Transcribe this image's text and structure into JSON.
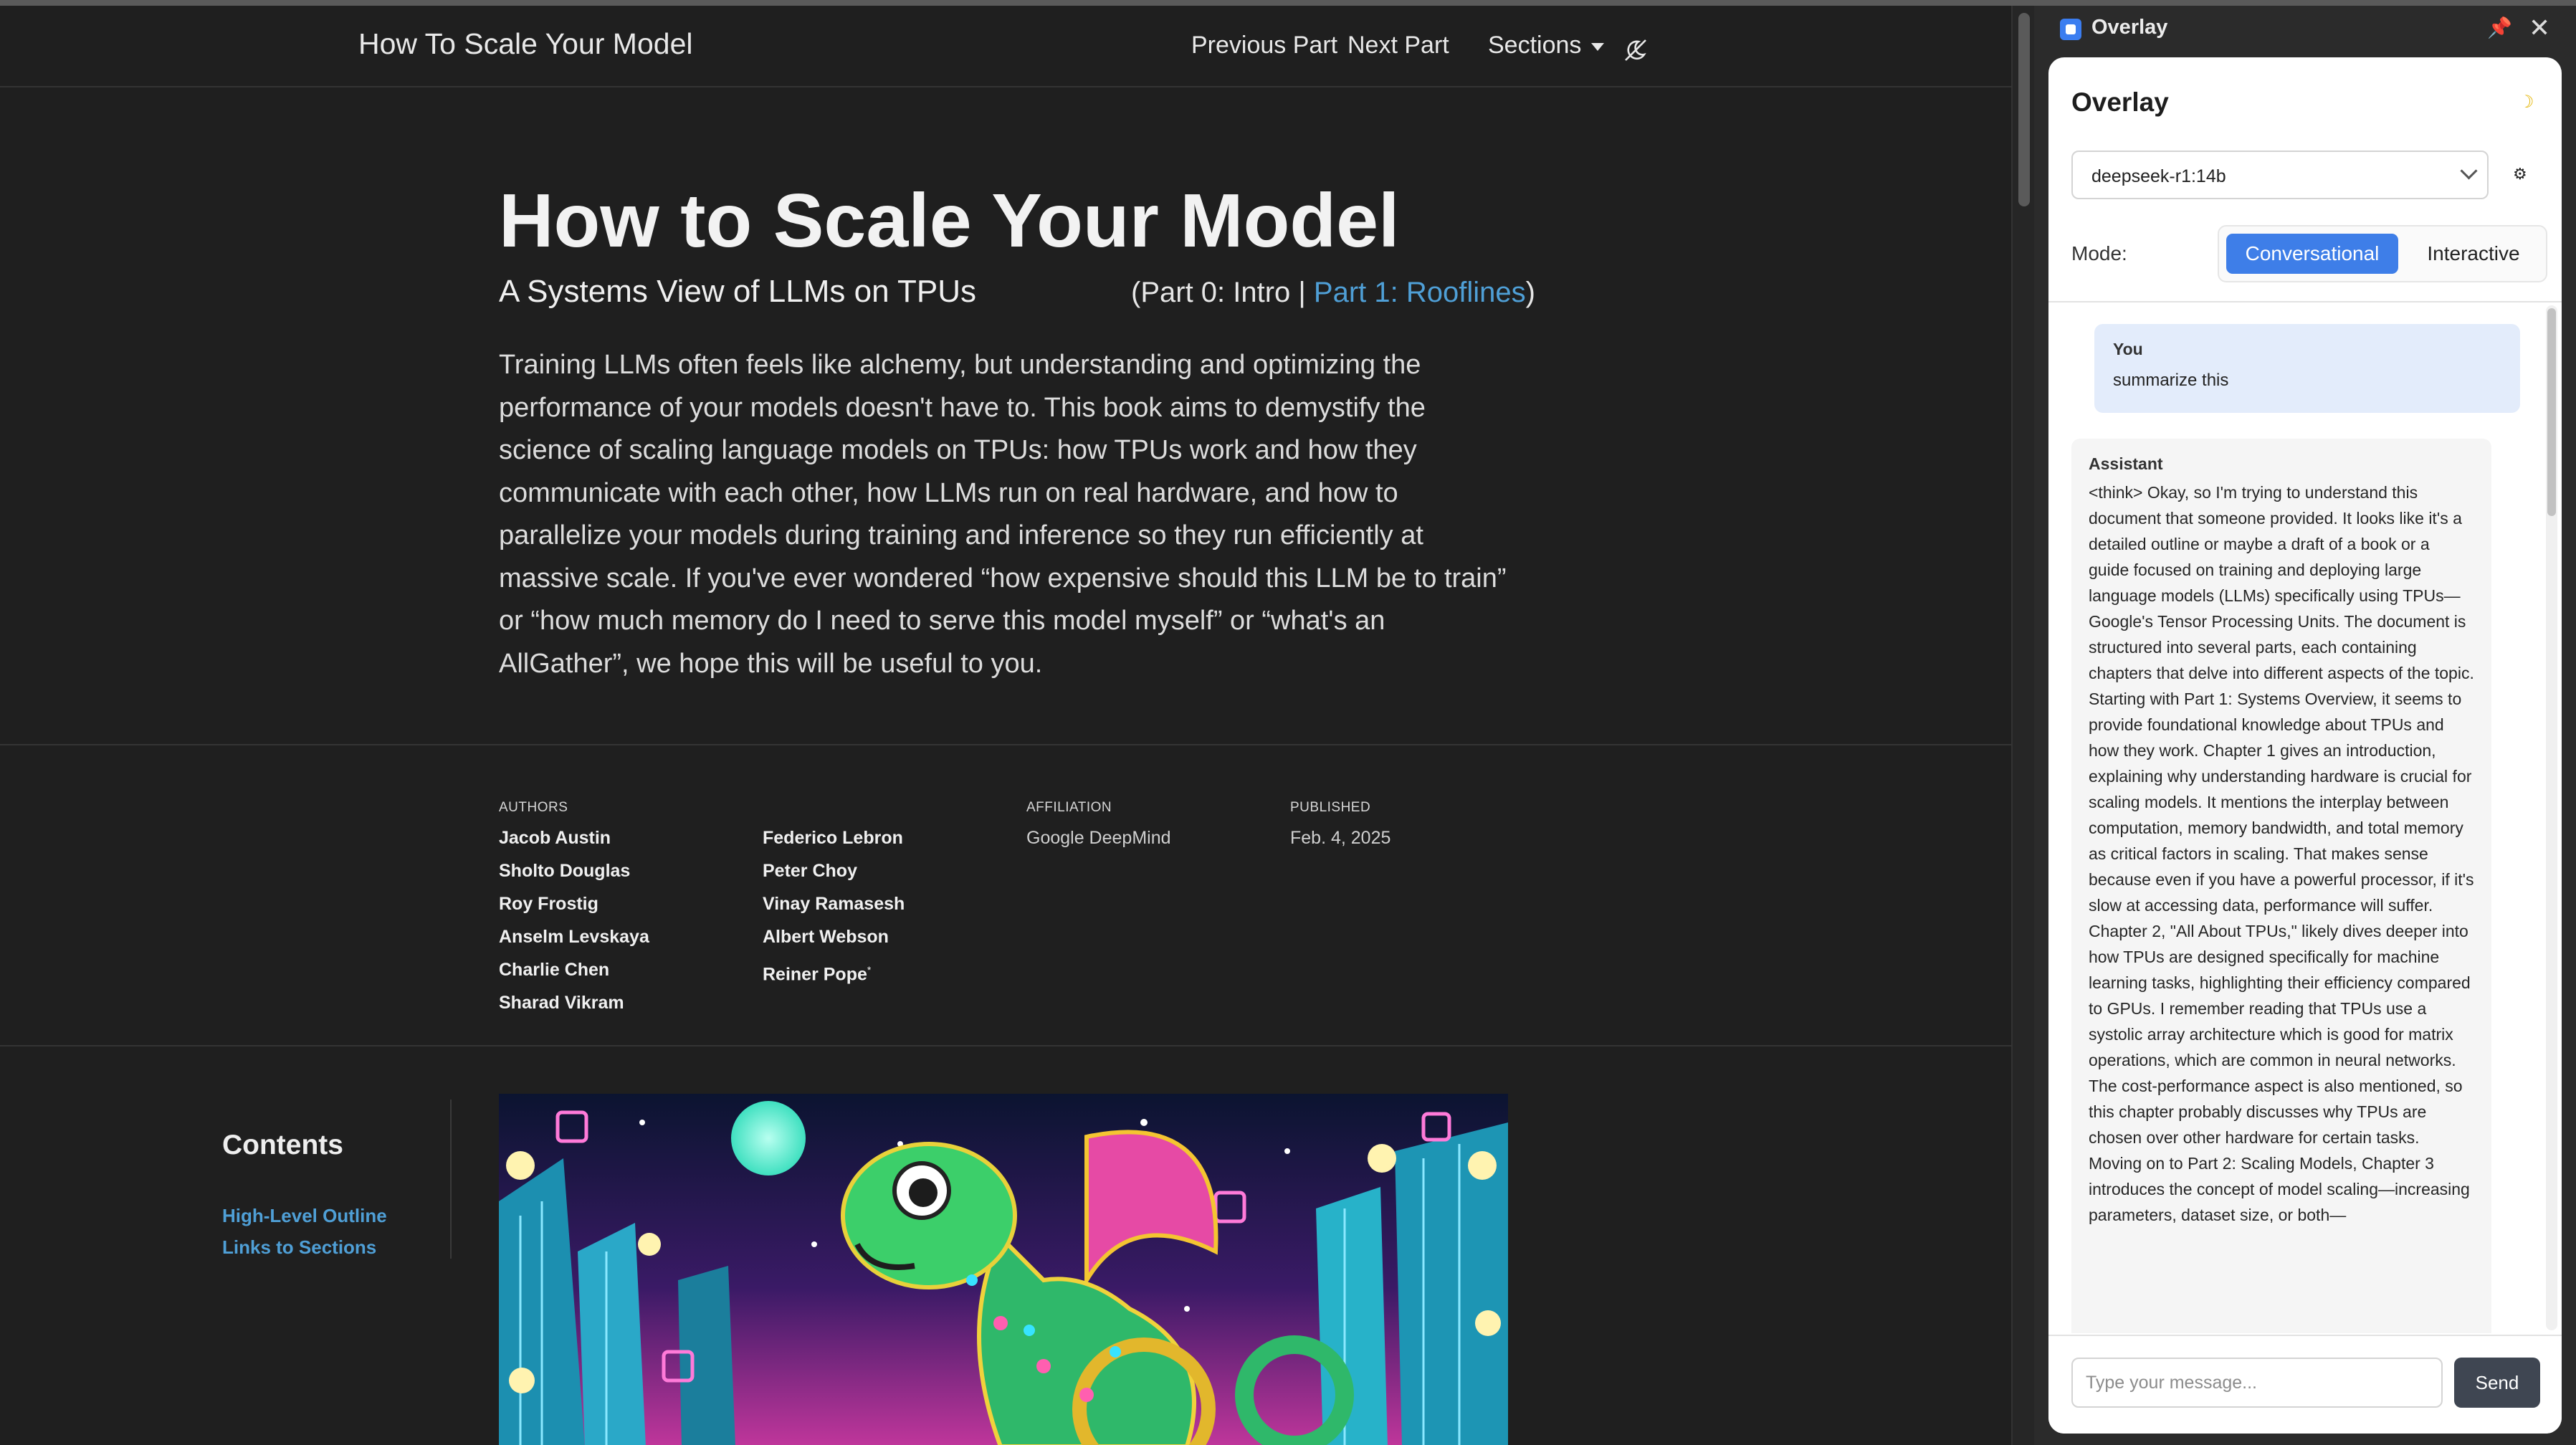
{
  "navbar": {
    "site_title": "How To Scale Your Model",
    "previous_part": "Previous Part",
    "next_part": "Next Part",
    "sections": "Sections"
  },
  "hero": {
    "title": "How to Scale Your Model",
    "subtitle": "A Systems View of LLMs on TPUs",
    "part_prefix": "(Part 0: Intro | ",
    "part_link": "Part 1: Rooflines",
    "part_suffix": ")",
    "intro": "Training LLMs often feels like alchemy, but understanding and optimizing the performance of your models doesn't have to. This book aims to demystify the science of scaling language models on TPUs: how TPUs work and how they communicate with each other, how LLMs run on real hardware, and how to parallelize your models during training and inference so they run efficiently at massive scale. If you've ever wondered “how expensive should this LLM be to train” or “how much memory do I need to serve this model myself” or “what's an AllGather”, we hope this will be useful to you."
  },
  "meta": {
    "authors_label": "AUTHORS",
    "authors_col1": [
      "Jacob Austin",
      "Sholto Douglas",
      "Roy Frostig",
      "Anselm Levskaya",
      "Charlie Chen",
      "Sharad Vikram"
    ],
    "authors_col2": [
      "Federico Lebron",
      "Peter Choy",
      "Vinay Ramasesh",
      "Albert Webson",
      "Reiner Pope"
    ],
    "reiner_mark": "*",
    "affiliation_label": "AFFILIATION",
    "affiliation": "Google DeepMind",
    "published_label": "PUBLISHED",
    "published": "Feb. 4, 2025"
  },
  "toc": {
    "title": "Contents",
    "links": [
      "High-Level Outline",
      "Links to Sections"
    ]
  },
  "overlay": {
    "window_title": "Overlay",
    "panel_title": "Overlay",
    "model": "deepseek-r1:14b",
    "mode_label": "Mode:",
    "mode_options": [
      "Conversational",
      "Interactive"
    ],
    "mode_selected": "Conversational",
    "messages": {
      "user_role": "You",
      "user_text": "summarize this",
      "assistant_role": "Assistant",
      "assistant_paragraphs": [
        "<think> Okay, so I'm trying to understand this document that someone provided. It looks like it's a detailed outline or maybe a draft of a book or a guide focused on training and deploying large language models (LLMs) specifically using TPUs—Google's Tensor Processing Units. The document is structured into several parts, each containing chapters that delve into different aspects of the topic.",
        "Starting with Part 1: Systems Overview, it seems to provide foundational knowledge about TPUs and how they work. Chapter 1 gives an introduction, explaining why understanding hardware is crucial for scaling models. It mentions the interplay between computation, memory bandwidth, and total memory as critical factors in scaling. That makes sense because even if you have a powerful processor, if it's slow at accessing data, performance will suffer. Chapter 2, \"All About TPUs,\" likely dives deeper into how TPUs are designed specifically for machine learning tasks, highlighting their efficiency compared to GPUs. I remember reading that TPUs use a systolic array architecture which is good for matrix operations, which are common in neural networks. The cost-performance aspect is also mentioned, so this chapter probably discusses why TPUs are chosen over other hardware for certain tasks.",
        "Moving on to Part 2: Scaling Models, Chapter 3 introduces the concept of model scaling—increasing parameters, dataset size, or both—"
      ]
    },
    "input_placeholder": "Type your message...",
    "input_value": "",
    "send_label": "Send",
    "accent_color": "#3e7ee8"
  }
}
